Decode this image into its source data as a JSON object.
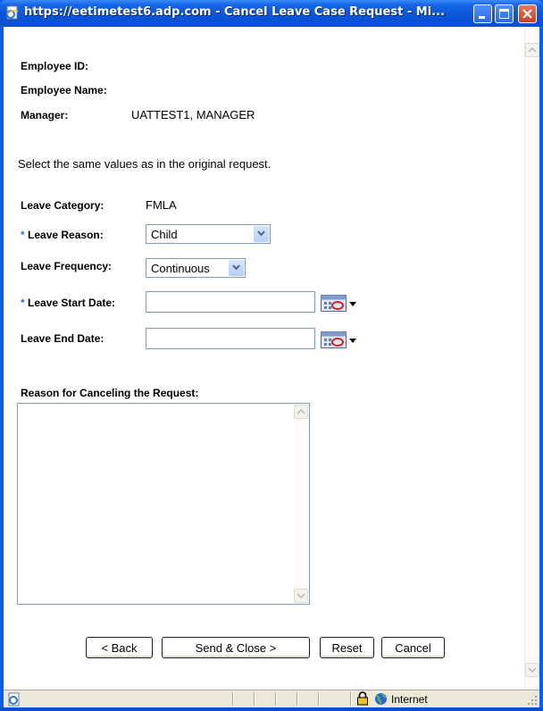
{
  "window": {
    "title": "https://eetimetest6.adp.com - Cancel Leave Case Request - Mi..."
  },
  "form": {
    "employee_id_label": "Employee ID:",
    "employee_id_value": "",
    "employee_name_label": "Employee Name:",
    "employee_name_value": "",
    "manager_label": "Manager:",
    "manager_value": "UATTEST1, MANAGER",
    "instruction": "Select the same values as in the original request.",
    "leave_category_label": "Leave Category:",
    "leave_category_value": "FMLA",
    "required_marker": "*",
    "leave_reason_label": "Leave Reason:",
    "leave_reason_value": "Child",
    "leave_frequency_label": "Leave Frequency:",
    "leave_frequency_value": "Continuous",
    "leave_start_label": "Leave Start Date:",
    "leave_start_value": "",
    "leave_end_label": "Leave End Date:",
    "leave_end_value": "",
    "cancel_reason_label": "Reason for Canceling the Request:",
    "cancel_reason_value": ""
  },
  "buttons": {
    "back": "< Back",
    "send_close": "Send & Close >",
    "reset": "Reset",
    "cancel": "Cancel"
  },
  "status": {
    "zone": "Internet"
  },
  "icons": {
    "title": "ie-page-icon",
    "status_page": "ie-page-icon",
    "lock": "lock-icon",
    "zone": "globe-icon",
    "calendar": "calendar-icon"
  },
  "colors": {
    "titlebar": "#0a55d8",
    "required_asterisk": "#3a74c8",
    "field_border": "#7f9db9"
  }
}
